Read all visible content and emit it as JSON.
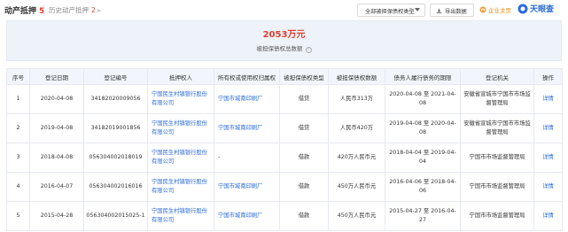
{
  "tabs": {
    "active": {
      "label": "动产抵押",
      "count": "5"
    },
    "history": {
      "label": "历史动产抵押",
      "count": "2",
      "chevron": ">"
    }
  },
  "toolbar": {
    "type_select": "全部被担保债权类型",
    "export_label": "导出数据",
    "enterprise_label": "企业主页",
    "logo_text": "天眼查"
  },
  "summary": {
    "amount": "2053万元",
    "label": "被担保债权总数额"
  },
  "table": {
    "headers": [
      "序号",
      "登记日期",
      "登记编号",
      "抵押权人",
      "所有权或使用权归属权",
      "被担保债权类型",
      "被担保债权数额",
      "债务人履行债务的期限",
      "登记机关",
      "操作"
    ],
    "rows": [
      {
        "index": "1",
        "date": "2020-04-08",
        "reg_no": "34182020009056",
        "mortgagee": "宁国民生村镇银行股份有限公司",
        "owner": "宁国市城南印刷厂",
        "debt_type": "借贷",
        "amount": "人民币313万",
        "term": "2020-04-08 至 2021-04-08",
        "authority": "安徽省宣城市宁国市市场监督管理局",
        "action": "详情"
      },
      {
        "index": "2",
        "date": "2019-04-08",
        "reg_no": "34182019001856",
        "mortgagee": "宁国民生村镇银行股份有限公司",
        "owner": "宁国市城南印刷厂",
        "debt_type": "借贷",
        "amount": "人民币420万",
        "term": "2019-04-08 至 2020-04-08",
        "authority": "安徽省宣城市宁国市市场监督管理局",
        "action": "详情"
      },
      {
        "index": "3",
        "date": "2018-04-08",
        "reg_no": "056304002018019",
        "mortgagee": "宁国民生村镇银行股份有限公司",
        "owner": "-",
        "debt_type": "借款",
        "amount": "420万人民币元",
        "term": "2018-04-04 至 2019-04-04",
        "authority": "宁国市市场监督管理局",
        "action": "详情"
      },
      {
        "index": "4",
        "date": "2016-04-07",
        "reg_no": "056304002016016",
        "mortgagee": "宁国民生村镇银行股份有限公司",
        "owner": "宁国市城南印刷厂",
        "debt_type": "借款",
        "amount": "450万人民币元",
        "term": "2016-04-06 至 2018-04-06",
        "authority": "宁国市市场监督管理局",
        "action": "详情"
      },
      {
        "index": "5",
        "date": "2015-04-28",
        "reg_no": "056304002015025-1",
        "mortgagee": "宁国民生村镇银行股份有限公司",
        "owner": "宁国市城南印刷厂",
        "debt_type": "借款",
        "amount": "450万人民币元",
        "term": "2015-04-27 至 2016-04-27",
        "authority": "宁国市市场监督管理局",
        "action": "详情"
      }
    ]
  },
  "colors": {
    "accent_red": "#e0402e",
    "link_blue": "#2a6bd8",
    "header_bg": "#f2f6fc",
    "summary_bg": "#eef3fa"
  }
}
